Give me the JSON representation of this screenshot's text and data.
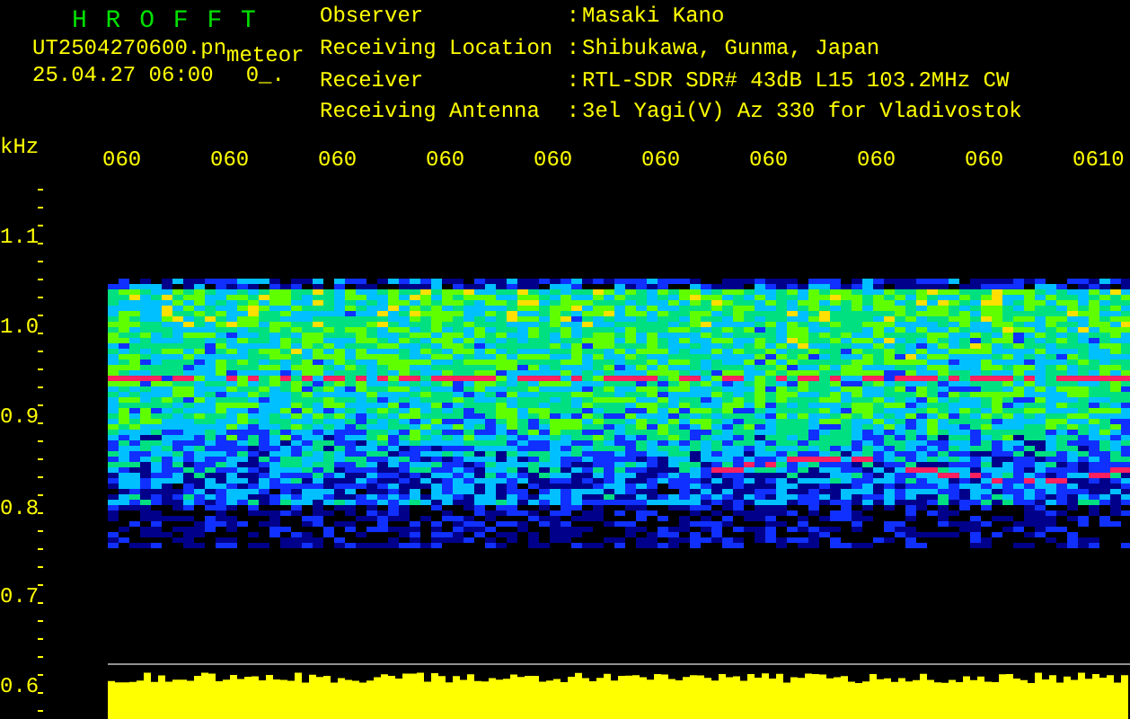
{
  "logo": "H R O F F T",
  "file_name": "UT2504270600.pn",
  "type_label": "meteor",
  "timestamp": "25.04.27 06:00",
  "counter": "0_.",
  "fields": [
    {
      "label": "Observer",
      "separator": ":",
      "value": "Masaki Kano"
    },
    {
      "label": "Receiving Location",
      "separator": ":",
      "value": "Shibukawa, Gunma, Japan"
    },
    {
      "label": "Receiver",
      "separator": ":",
      "value": "RTL-SDR SDR# 43dB L15 103.2MHz CW"
    },
    {
      "label": "Receiving Antenna",
      "separator": ":",
      "value": "3el Yagi(V) Az 330 for Vladivostok"
    }
  ],
  "y_unit": "kHz",
  "y_labels": [
    "1.1",
    "1.0",
    "0.9",
    "0.8",
    "0.7",
    "0.6"
  ],
  "time_labels": [
    "060",
    "060",
    "060",
    "060",
    "060",
    "060",
    "060",
    "060",
    "060",
    "0610"
  ]
}
